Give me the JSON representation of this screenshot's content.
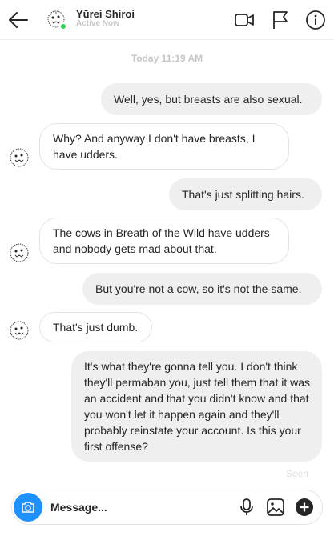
{
  "header": {
    "contact_name": "Yūrei Shiroi",
    "status": "Active Now",
    "icons": [
      "back-arrow-icon",
      "video-call-icon",
      "flag-icon",
      "info-icon"
    ]
  },
  "timestamp": "Today 11:19 AM",
  "messages": [
    {
      "side": "out",
      "text": "Well, yes, but breasts are also sexual."
    },
    {
      "side": "in",
      "text": "Why? And anyway I don't have breasts, I have udders."
    },
    {
      "side": "out",
      "text": "That's just splitting hairs."
    },
    {
      "side": "in",
      "text": "The cows in Breath of the Wild have udders and nobody gets mad about that."
    },
    {
      "side": "out",
      "text": "But you're not a cow, so it's not the same."
    },
    {
      "side": "in",
      "text": "That's just dumb."
    },
    {
      "side": "out",
      "text": "It's what they're gonna tell you. I don't think they'll permaban you, just tell them that it was an accident and that you didn't know and that you won't let it happen again and they'll probably reinstate your account. Is this your first offense?"
    }
  ],
  "seen_label": "Seen",
  "composer": {
    "placeholder": "Message...",
    "icons": [
      "camera-icon",
      "microphone-icon",
      "image-icon",
      "add-icon"
    ]
  },
  "colors": {
    "outgoing_bubble": "#efefef",
    "incoming_border": "#e3e3e3",
    "online": "#2ed84f",
    "camera_button": "#1e90ff"
  }
}
